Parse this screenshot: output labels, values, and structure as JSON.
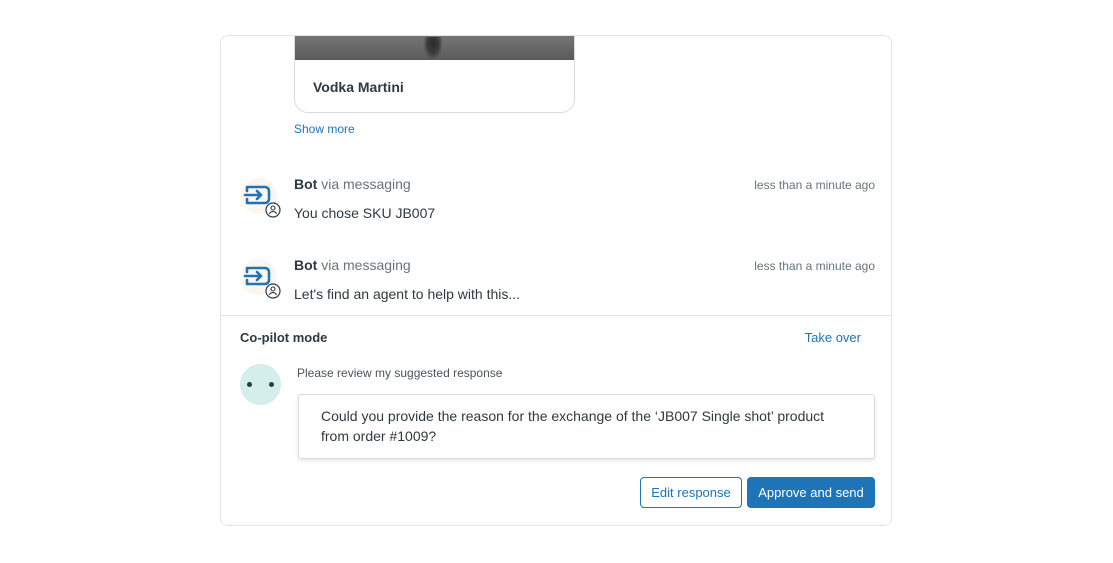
{
  "card": {
    "title": "Vodka Martini",
    "show_more": "Show more"
  },
  "messages": [
    {
      "sender": "Bot",
      "channel": "via messaging",
      "time": "less than a minute ago",
      "text": "You chose SKU JB007"
    },
    {
      "sender": "Bot",
      "channel": "via messaging",
      "time": "less than a minute ago",
      "text": "Let's find an agent to help with this..."
    }
  ],
  "copilot": {
    "label": "Co-pilot mode",
    "take_over": "Take over",
    "review_label": "Please review my suggested response",
    "suggestion": "Could you provide the reason for the exchange of the ‘JB007 Single shot’ product from order #1009?",
    "edit_button": "Edit response",
    "approve_button": "Approve and send"
  },
  "colors": {
    "accent": "#1f73b7",
    "bot_icon": "#1f73b7",
    "copilot_avatar_bg": "#d3eeeb",
    "border": "#e3e5e8"
  },
  "icons": {
    "bot_avatar": "bot-arrow-icon",
    "user_badge": "user-circle-icon",
    "copilot_avatar": "copilot-face-icon"
  }
}
